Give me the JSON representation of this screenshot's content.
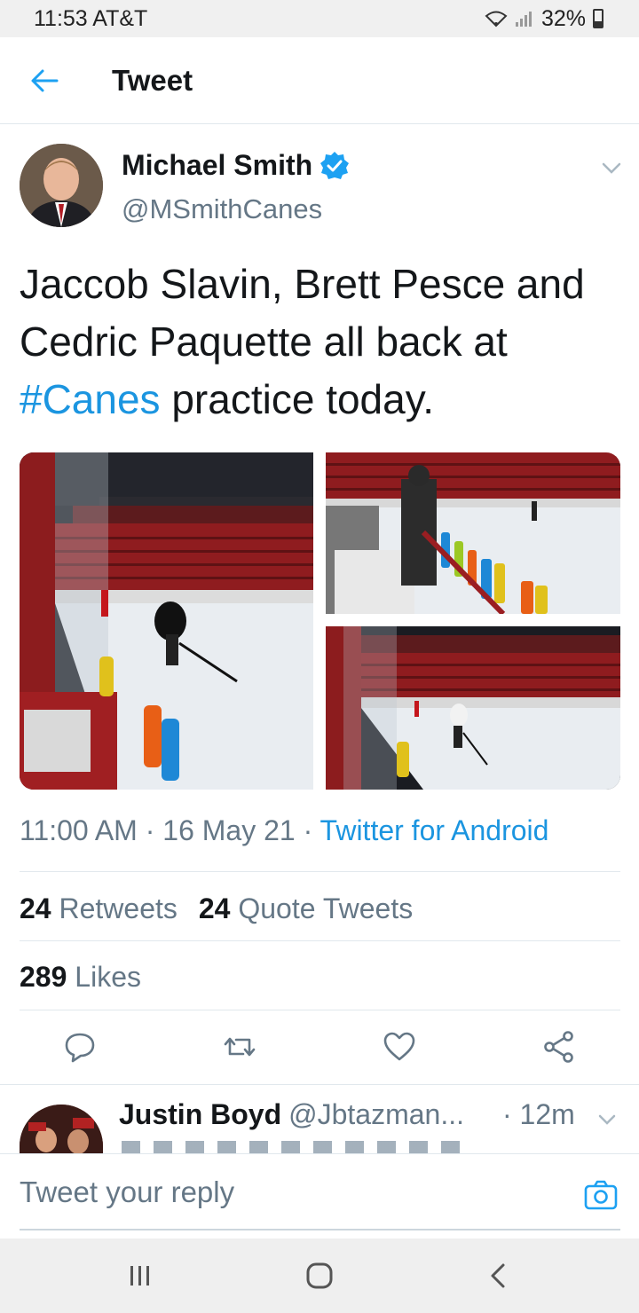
{
  "status_bar": {
    "time": "11:53 AT&T",
    "battery": "32%"
  },
  "header": {
    "title": "Tweet"
  },
  "tweet": {
    "author_name": "Michael Smith",
    "author_handle": "@MSmithCanes",
    "text_part1": "Jaccob Slavin, Brett Pesce and Cedric Paquette all back at ",
    "hashtag": "#Canes",
    "text_part2": " practice today.",
    "time": "11:00 AM",
    "date": "16 May 21",
    "source": "Twitter for Android"
  },
  "stats": {
    "retweets_count": "24",
    "retweets_label": "Retweets",
    "quotes_count": "24",
    "quotes_label": "Quote Tweets",
    "likes_count": "289",
    "likes_label": "Likes"
  },
  "reply": {
    "name": "Justin Boyd",
    "handle": "@Jbtazman...",
    "time": "· 12m"
  },
  "composer": {
    "placeholder": "Tweet your reply"
  },
  "colors": {
    "accent": "#1b95e0",
    "secondary_text": "#657786",
    "primary_text": "#14171a",
    "divider": "#e1e8ed"
  }
}
